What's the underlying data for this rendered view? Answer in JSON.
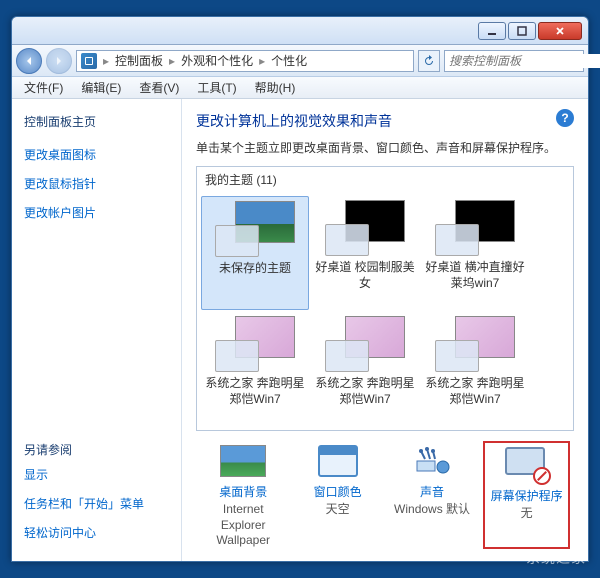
{
  "breadcrumb": {
    "root": "控制面板",
    "mid": "外观和个性化",
    "leaf": "个性化"
  },
  "search": {
    "placeholder": "搜索控制面板"
  },
  "menus": {
    "file": "文件(F)",
    "edit": "编辑(E)",
    "view": "查看(V)",
    "tools": "工具(T)",
    "help": "帮助(H)"
  },
  "sidebar": {
    "home": "控制面板主页",
    "links": [
      "更改桌面图标",
      "更改鼠标指针",
      "更改帐户图片"
    ],
    "seealso": "另请参阅",
    "extras": [
      "显示",
      "任务栏和「开始」菜单",
      "轻松访问中心"
    ]
  },
  "content": {
    "title": "更改计算机上的视觉效果和声音",
    "subtitle": "单击某个主题立即更改桌面背景、窗口颜色、声音和屏幕保护程序。",
    "mythemes": "我的主题 (11)",
    "themes": [
      {
        "name": "未保存的主题",
        "kind": "nature",
        "sel": true
      },
      {
        "name": "好桌道 校园制服美女",
        "kind": "dark"
      },
      {
        "name": "好桌道 横冲直撞好莱坞win7",
        "kind": "dark"
      },
      {
        "name": "系统之家 奔跑明星郑恺Win7",
        "kind": "kungfu"
      },
      {
        "name": "系统之家 奔跑明星郑恺Win7",
        "kind": "kungfu"
      },
      {
        "name": "系统之家 奔跑明星郑恺Win7",
        "kind": "kungfu"
      }
    ],
    "options": {
      "bg": {
        "t": "桌面背景",
        "v": "Internet Explorer Wallpaper"
      },
      "color": {
        "t": "窗口颜色",
        "v": "天空"
      },
      "sound": {
        "t": "声音",
        "v": "Windows 默认"
      },
      "ss": {
        "t": "屏幕保护程序",
        "v": "无"
      }
    }
  },
  "help": "?",
  "watermark": "系统之家"
}
